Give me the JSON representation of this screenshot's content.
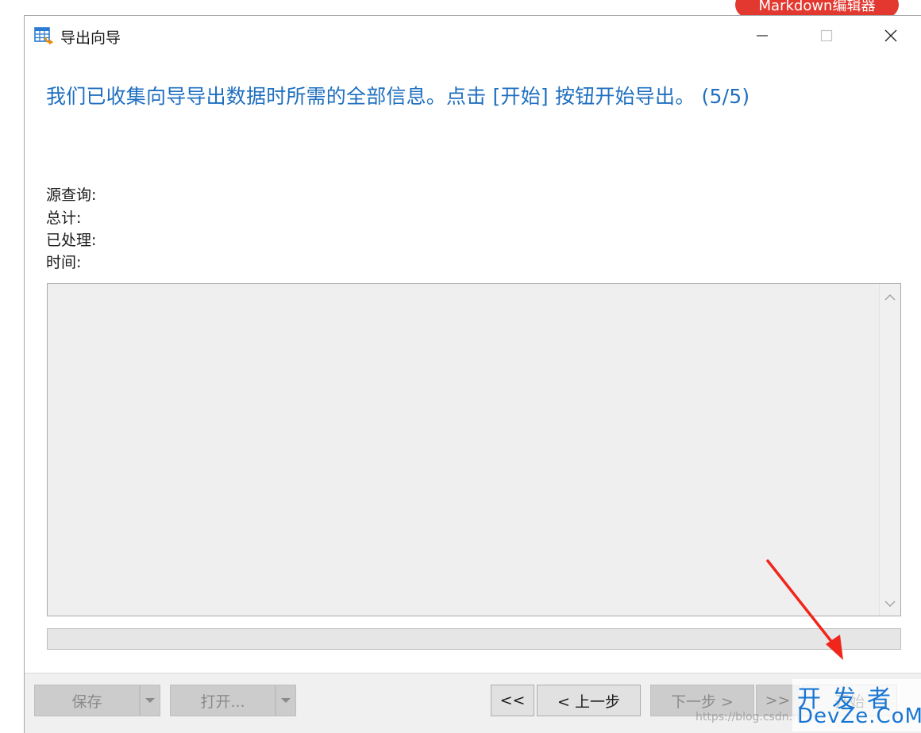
{
  "background_page": {
    "badge_label": "Markdown编辑器"
  },
  "window": {
    "title": "导出向导",
    "icon": "table-export-icon",
    "controls": {
      "minimize": "minimize-icon",
      "maximize": "maximize-icon",
      "close": "close-icon"
    }
  },
  "main": {
    "heading": "我们已收集向导导出数据时所需的全部信息。点击 [开始] 按钮开始导出。 (5/5)",
    "info": {
      "source_query": "源查询:",
      "total": "总计:",
      "processed": "已处理:",
      "time": "时间:"
    },
    "progress": 0
  },
  "footer": {
    "save": "保存",
    "open": "打开...",
    "first": "<<",
    "prev": "< 上一步",
    "next": "下一步 >",
    "last": ">>",
    "start": "开始"
  },
  "watermark": {
    "url": "https://blog.csdn.n",
    "logo_top": "开发者",
    "logo_bottom": "DevZe.CoM"
  },
  "colors": {
    "heading": "#1f6fc0",
    "badge": "#e2382f",
    "annotation_arrow": "#f0261c",
    "watermark": "#1976d2"
  }
}
